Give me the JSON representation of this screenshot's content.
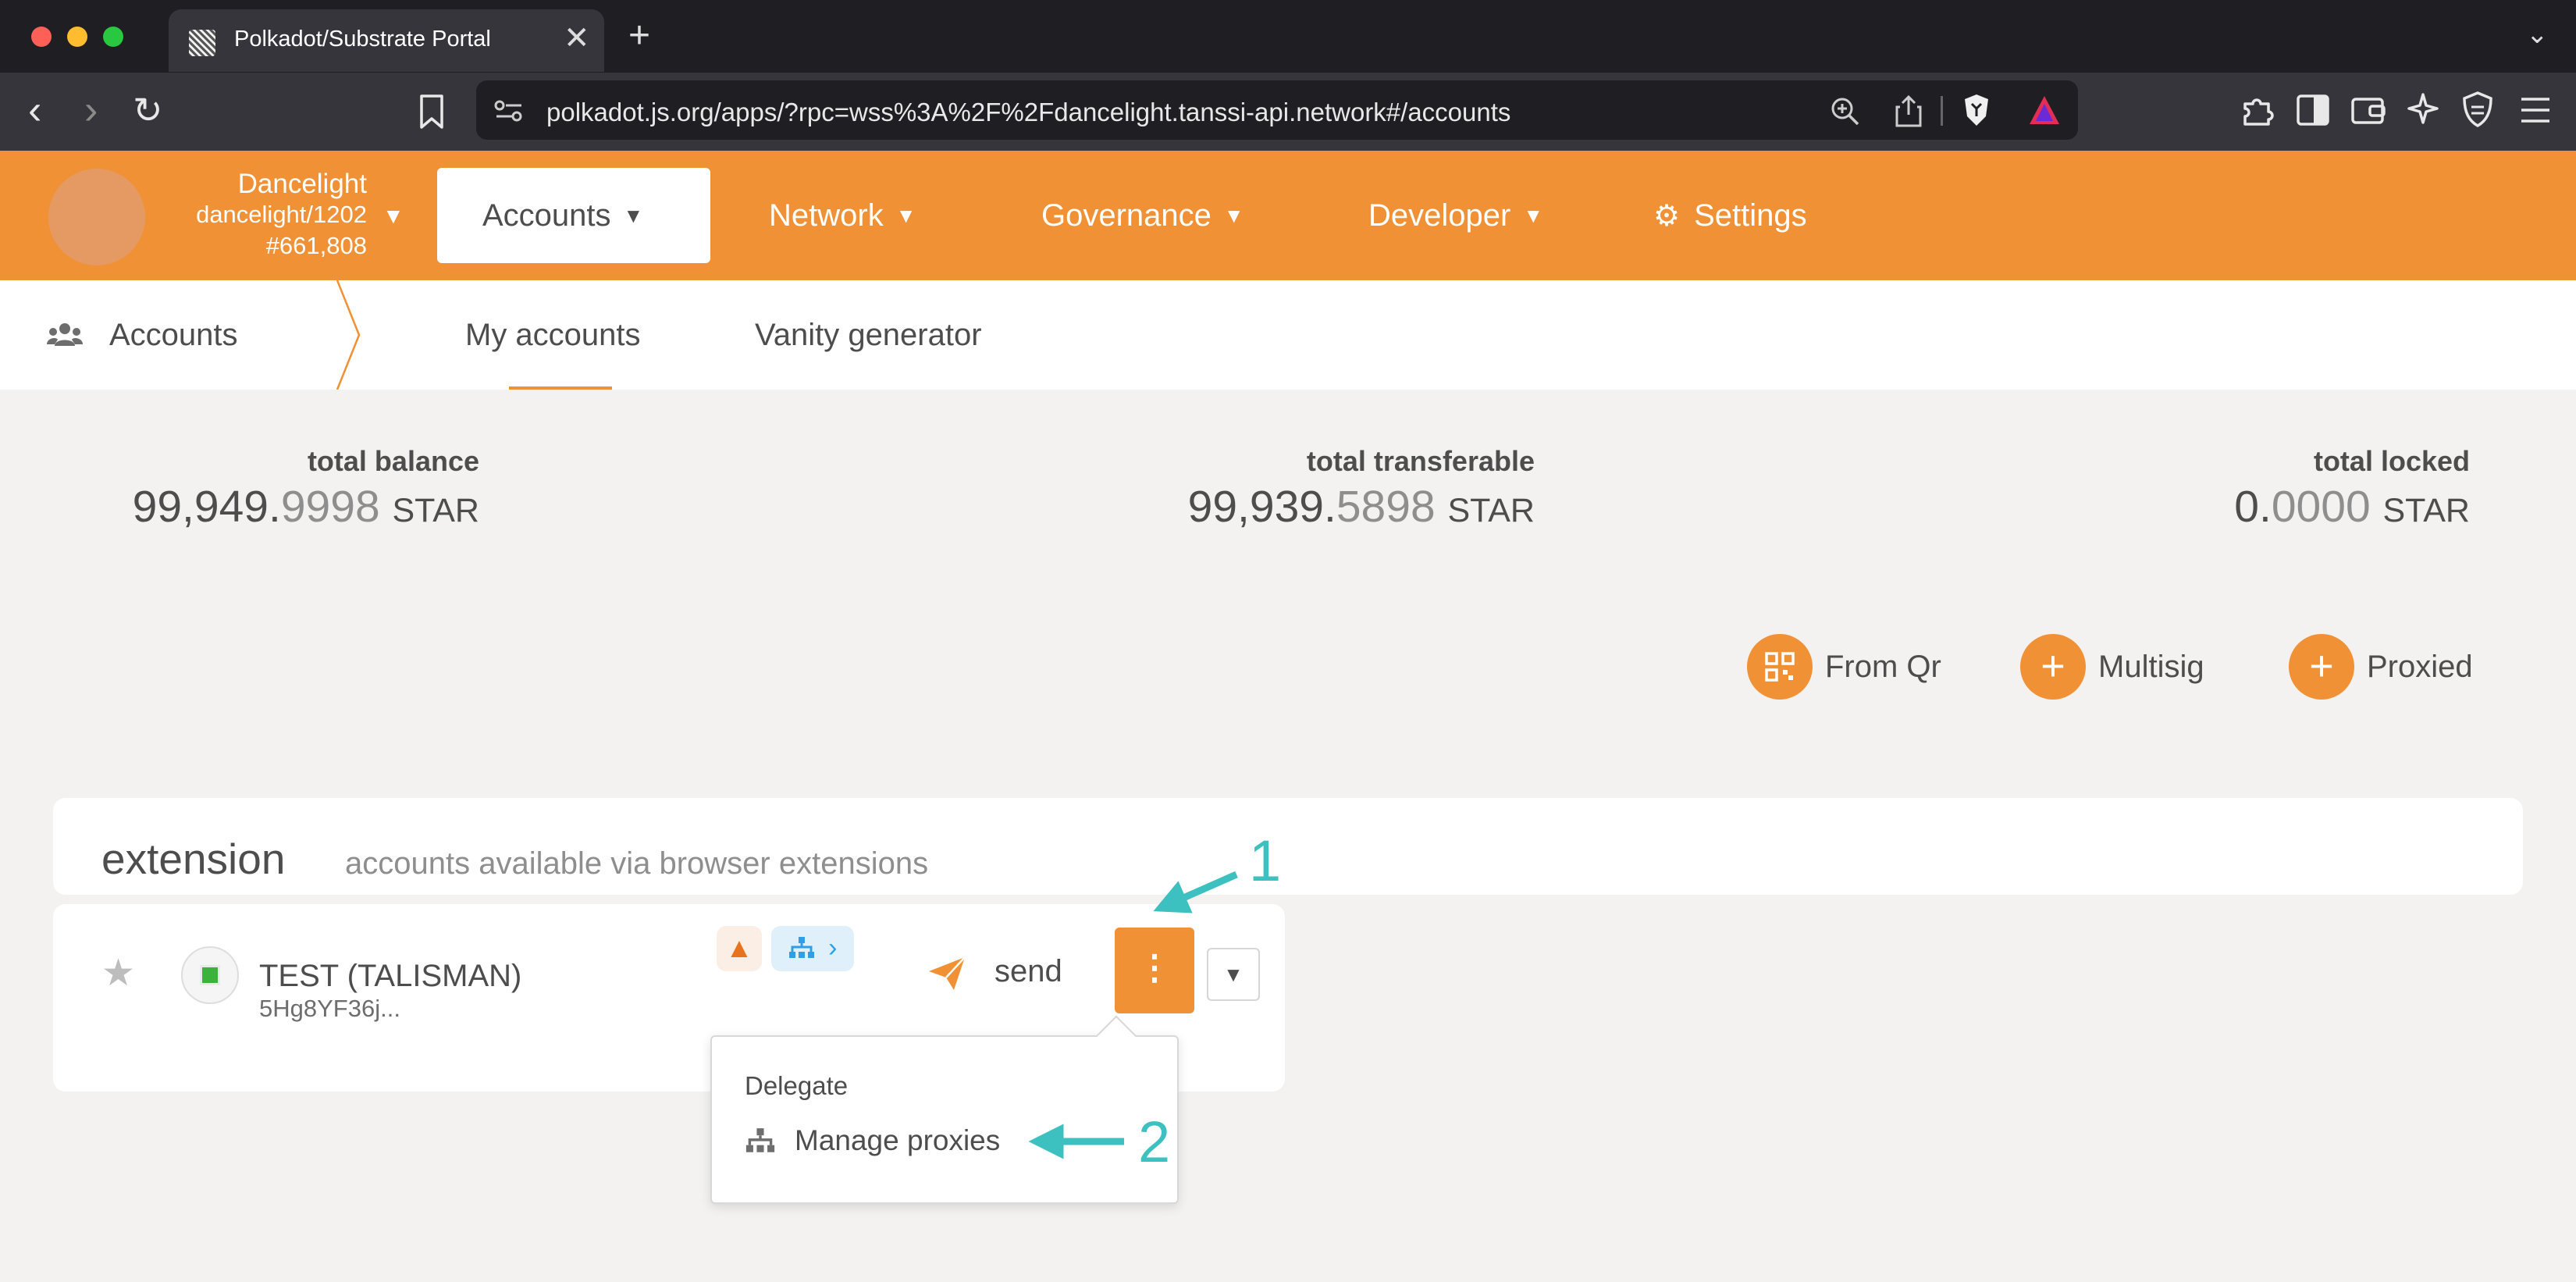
{
  "browser": {
    "tab_title": "Polkadot/Substrate Portal",
    "tab_close": "✕",
    "new_tab": "+",
    "tabs_menu": "⌄",
    "url": "polkadot.js.org/apps/?rpc=wss%3A%2F%2Fdancelight.tanssi-api.network#/accounts",
    "nav": {
      "back": "‹",
      "forward": "›",
      "reload": "↻"
    }
  },
  "chain": {
    "name": "Dancelight",
    "spec": "dancelight/1202",
    "block": "#661,808"
  },
  "menu": {
    "items": [
      {
        "label": "Accounts"
      },
      {
        "label": "Network"
      },
      {
        "label": "Governance"
      },
      {
        "label": "Developer"
      },
      {
        "label": "Settings"
      }
    ]
  },
  "subnav": {
    "title": "Accounts",
    "tabs": [
      {
        "label": "My accounts"
      },
      {
        "label": "Vanity generator"
      }
    ]
  },
  "summary": {
    "total_balance": {
      "label": "total balance",
      "int": "99,949.",
      "dec": "9998",
      "unit": "STAR"
    },
    "total_transferable": {
      "label": "total transferable",
      "int": "99,939.",
      "dec": "5898",
      "unit": "STAR"
    },
    "total_locked": {
      "label": "total locked",
      "int": "0.",
      "dec": "0000",
      "unit": "STAR"
    }
  },
  "actions": {
    "from_qr": "From Qr",
    "multisig": "Multisig",
    "proxied": "Proxied"
  },
  "extension": {
    "title": "extension",
    "subtitle": "accounts available via browser extensions"
  },
  "account": {
    "name": "TEST (TALISMAN)",
    "address": "5Hg8YF36j...",
    "send_label": "send"
  },
  "popup": {
    "section": "Delegate",
    "item": "Manage proxies"
  },
  "annotations": {
    "step1": "1",
    "step2": "2"
  },
  "colors": {
    "accent": "#f19135",
    "annotation": "#3cc1c0",
    "chrome_dark": "#1f1e23"
  },
  "icons": {
    "settings": "gears-icon",
    "accounts": "users-icon",
    "qr": "qrcode-icon",
    "plus": "plus-icon",
    "warning": "warning-icon",
    "proxy": "sitemap-icon",
    "send": "paper-plane-icon",
    "menu": "ellipsis-vertical-icon"
  }
}
